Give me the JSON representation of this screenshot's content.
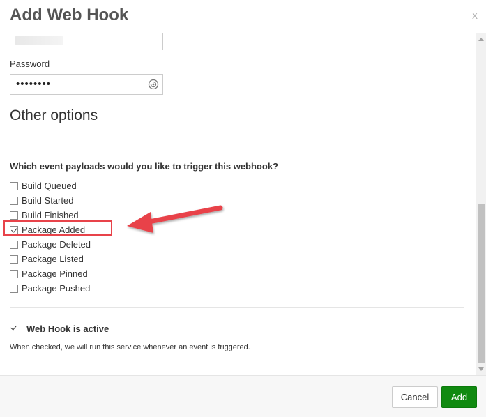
{
  "dialog": {
    "title": "Add Web Hook",
    "close_label": "x"
  },
  "form": {
    "password_label": "Password",
    "password_value": "••••••••",
    "other_options_title": "Other options",
    "events_question": "Which event payloads would you like to trigger this webhook?",
    "events": [
      {
        "label": "Build Queued",
        "checked": false
      },
      {
        "label": "Build Started",
        "checked": false
      },
      {
        "label": "Build Finished",
        "checked": false
      },
      {
        "label": "Package Added",
        "checked": true
      },
      {
        "label": "Package Deleted",
        "checked": false
      },
      {
        "label": "Package Listed",
        "checked": false
      },
      {
        "label": "Package Pinned",
        "checked": false
      },
      {
        "label": "Package Pushed",
        "checked": false
      }
    ],
    "active_label": "Web Hook is active",
    "active_checked": true,
    "active_help": "When checked, we will run this service whenever an event is triggered."
  },
  "footer": {
    "cancel_label": "Cancel",
    "add_label": "Add"
  },
  "colors": {
    "add_button": "#108a10",
    "annotation": "#e8434a"
  },
  "icons": {
    "reveal_password": "eye-reveal-icon",
    "annotation_arrow": "arrow-left-icon"
  }
}
